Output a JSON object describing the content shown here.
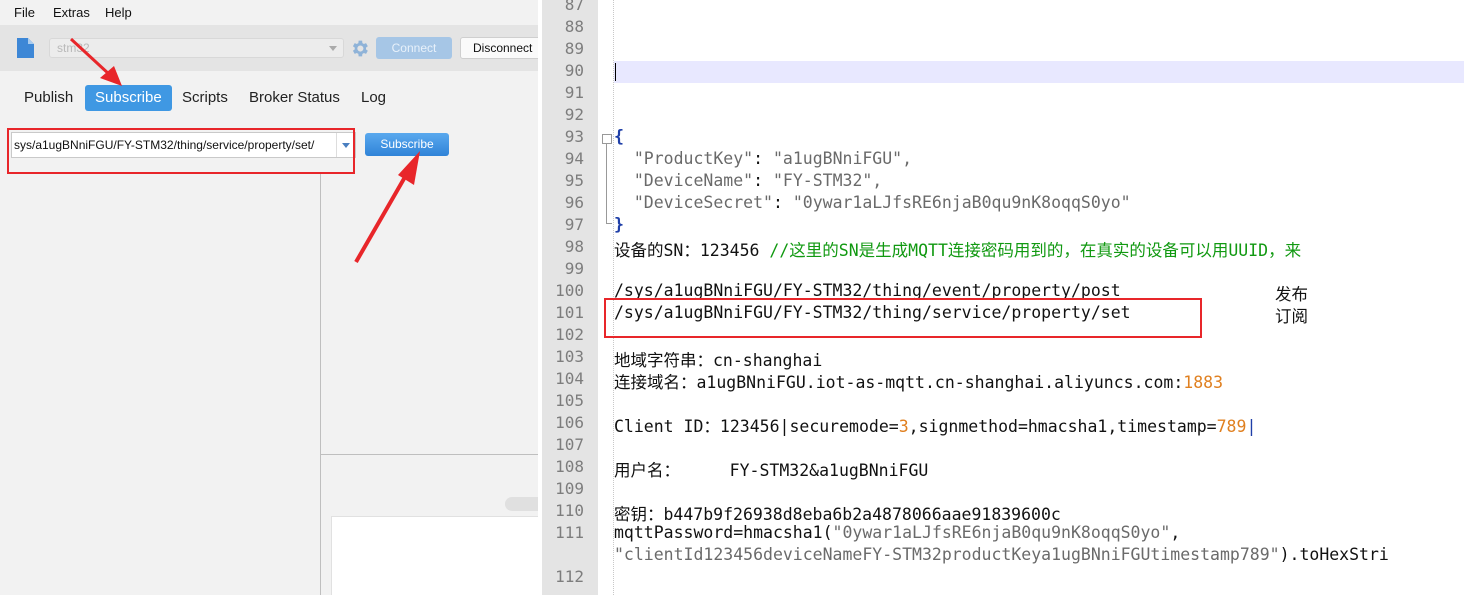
{
  "menu": [
    "File",
    "Extras",
    "Help"
  ],
  "toolbar": {
    "profile_value": "stm32",
    "connect_label": "Connect",
    "disconnect_label": "Disconnect"
  },
  "tabs": [
    "Publish",
    "Subscribe",
    "Scripts",
    "Broker Status",
    "Log"
  ],
  "subscribe": {
    "topic_value": "/sys/a1ugBNniFGU/FY-STM32/thing/service/property/set",
    "button_label": "Subscribe"
  },
  "editor": {
    "line_numbers": [
      "87",
      "88",
      "89",
      "90",
      "91",
      "92",
      "93",
      "94",
      "95",
      "96",
      "97",
      "98",
      "99",
      "100",
      "101",
      "102",
      "103",
      "104",
      "105",
      "106",
      "107",
      "108",
      "109",
      "110",
      "111",
      "",
      "112"
    ],
    "json_open": "{",
    "product_key_key": "\"ProductKey\"",
    "product_key_value": "\"a1ugBNniFGU\",",
    "device_name_key": "\"DeviceName\"",
    "device_name_value": "\"FY-STM32\",",
    "device_secret_key": "\"DeviceSecret\"",
    "device_secret_value": "\"0ywar1aLJfsRE6njaB0qu9nK8oqqS0yo\"",
    "json_close": "}",
    "sn_line": "设备的SN：123456 ",
    "sn_comment": "//这里的SN是生成MQTT连接密码用到的，在真实的设备可以用UUID，来",
    "topic_post": "/sys/a1ugBNniFGU/FY-STM32/thing/event/property/post",
    "topic_post_label": "发布",
    "topic_set": "/sys/a1ugBNniFGU/FY-STM32/thing/service/property/set",
    "topic_set_label": "订阅",
    "region_line": "地域字符串：cn-shanghai",
    "host_line": "连接域名：a1ugBNniFGU.iot-as-mqtt.cn-shanghai.aliyuncs.com:",
    "host_port": "1883",
    "client_id_a": "Client ID：123456",
    "client_id_b": "|securemode=",
    "client_id_c": "3",
    "client_id_d": ",signmethod=hmacsha1,timestamp=",
    "client_id_e": "789",
    "client_id_f": "|",
    "username_line": "用户名：     FY-STM32&a1ugBNniFGU",
    "secret_line": "密钥：b447b9f26938d8eba6b2a4878066aae91839600c",
    "mqtt_password_a": "mqttPassword=hmacsha1(",
    "mqtt_password_b": "\"0ywar1aLJfsRE6njaB0qu9nK8oqqS0yo\"",
    "mqtt_password_c": ",",
    "client_string": "\"clientId123456deviceNameFY-STM32productKeya1ugBNniFGUtimestamp789\"",
    "client_string_tail": ").toHexStri"
  },
  "colors": {
    "accent_blue": "#3f98e3",
    "annotation_red": "#e8262a",
    "comment_green": "#119911",
    "number_orange": "#e08020"
  }
}
